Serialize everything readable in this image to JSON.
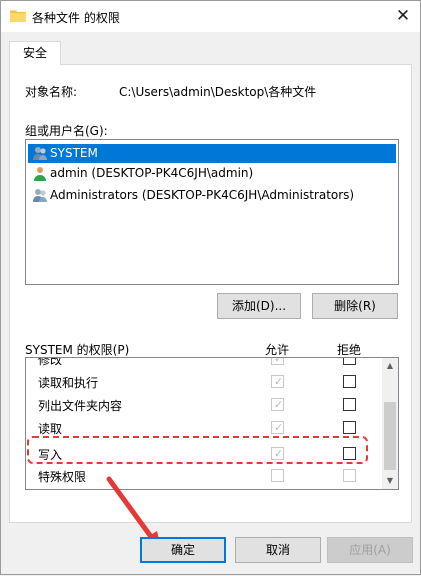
{
  "window": {
    "title": "各种文件 的权限",
    "close_glyph": "✕"
  },
  "tab": {
    "label": "安全"
  },
  "object": {
    "label": "对象名称:",
    "value": "C:\\Users\\admin\\Desktop\\各种文件"
  },
  "groups": {
    "label": "组或用户名(G):",
    "items": [
      {
        "label": "SYSTEM",
        "selected": true
      },
      {
        "label": "admin (DESKTOP-PK4C6JH\\admin)",
        "selected": false
      },
      {
        "label": "Administrators (DESKTOP-PK4C6JH\\Administrators)",
        "selected": false
      }
    ]
  },
  "buttons": {
    "add": "添加(D)...",
    "remove": "删除(R)",
    "ok": "确定",
    "cancel": "取消",
    "apply": "应用(A)"
  },
  "permissions": {
    "label": "SYSTEM 的权限(P)",
    "allow_header": "允许",
    "deny_header": "拒绝",
    "rows": [
      {
        "name": "修改",
        "allow": true,
        "deny": false
      },
      {
        "name": "读取和执行",
        "allow": true,
        "deny": false
      },
      {
        "name": "列出文件夹内容",
        "allow": true,
        "deny": false
      },
      {
        "name": "读取",
        "allow": true,
        "deny": false
      },
      {
        "name": "写入",
        "allow": true,
        "deny": false
      },
      {
        "name": "特殊权限",
        "allow": false,
        "deny": false
      }
    ]
  },
  "colors": {
    "selection": "#0078d7",
    "annotation": "#e53935"
  }
}
